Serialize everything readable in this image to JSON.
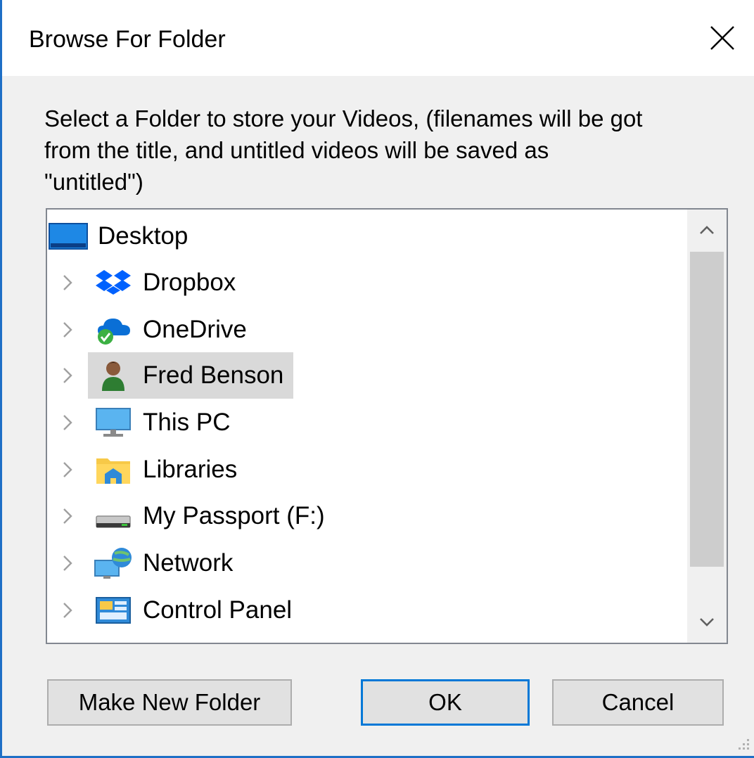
{
  "window": {
    "title": "Browse For Folder",
    "prompt_line1": "Select a Folder to store your Videos, (filenames will be got",
    "prompt_line2": "from the title, and untitled videos will be saved as",
    "prompt_line3": "\"untitled\")",
    "accent_color": "#0078d7"
  },
  "tree": {
    "root": {
      "label": "Desktop",
      "icon": "desktop-icon"
    },
    "items": [
      {
        "label": "Dropbox",
        "icon": "dropbox-icon",
        "selected": false
      },
      {
        "label": "OneDrive",
        "icon": "onedrive-icon",
        "selected": false
      },
      {
        "label": "Fred Benson",
        "icon": "user-icon",
        "selected": true
      },
      {
        "label": "This PC",
        "icon": "computer-icon",
        "selected": false
      },
      {
        "label": "Libraries",
        "icon": "libraries-icon",
        "selected": false
      },
      {
        "label": "My Passport (F:)",
        "icon": "drive-icon",
        "selected": false
      },
      {
        "label": "Network",
        "icon": "network-icon",
        "selected": false
      },
      {
        "label": "Control Panel",
        "icon": "control-panel-icon",
        "selected": false
      }
    ]
  },
  "buttons": {
    "make_new_folder": "Make New Folder",
    "ok": "OK",
    "cancel": "Cancel"
  }
}
